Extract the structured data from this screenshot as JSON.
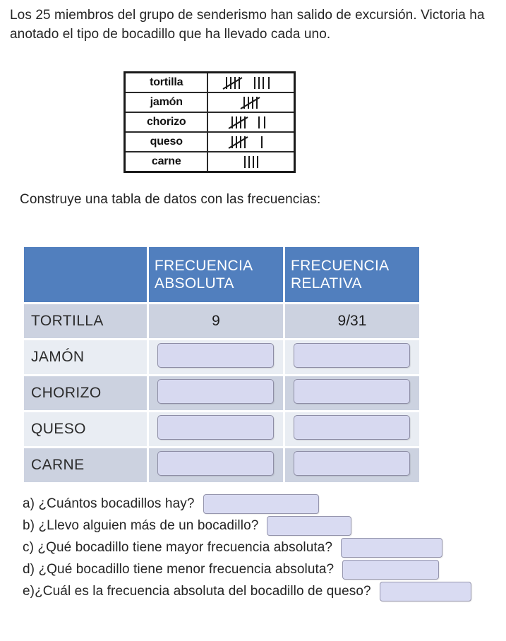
{
  "intro": "Los 25 miembros del grupo de senderismo han salido de excursión. Victoria ha anotado el tipo de bocadillo  que ha llevado cada uno.",
  "construye": "Construye una tabla de datos con las frecuencias:",
  "tally": {
    "rows": [
      {
        "name": "tortilla",
        "fives": 1,
        "ones": 4,
        "count": 9
      },
      {
        "name": "jamón",
        "fives": 1,
        "ones": 0,
        "count": 5
      },
      {
        "name": "chorizo",
        "fives": 1,
        "ones": 2,
        "count": 7
      },
      {
        "name": "queso",
        "fives": 1,
        "ones": 1,
        "count": 6
      },
      {
        "name": "carne",
        "fives": 0,
        "ones": 4,
        "count": 4
      }
    ]
  },
  "freq_table": {
    "header": {
      "blank": "",
      "absolute": "FRECUENCIA ABSOLUTA",
      "absolute_line1": "FRECUENCIA",
      "absolute_line2": "ABSOLUTA",
      "relative_line1": "FRECUENCIA",
      "relative_line2": "RELATIVA"
    },
    "rows": [
      {
        "label": "TORTILLA",
        "absolute": "9",
        "relative": "9/31",
        "filled": true
      },
      {
        "label": "JAMÓN",
        "absolute": "",
        "relative": "",
        "filled": false
      },
      {
        "label": "CHORIZO",
        "absolute": "",
        "relative": "",
        "filled": false
      },
      {
        "label": "QUESO",
        "absolute": "",
        "relative": "",
        "filled": false
      },
      {
        "label": "CARNE",
        "absolute": "",
        "relative": "",
        "filled": false
      }
    ]
  },
  "questions": [
    {
      "text": "a) ¿Cuántos bocadillos hay?",
      "answer": ""
    },
    {
      "text": "b) ¿Llevo alguien más de un bocadillo?",
      "answer": ""
    },
    {
      "text": "c) ¿Qué bocadillo tiene mayor frecuencia absoluta?",
      "answer": ""
    },
    {
      "text": "d) ¿Qué bocadillo tiene menor frecuencia absoluta?",
      "answer": ""
    },
    {
      "text": "e)¿Cuál es la frecuencia absoluta del bocadillo de queso?",
      "answer": ""
    }
  ],
  "colors": {
    "header_blue": "#517fbe",
    "row_dark": "#ccd2e0",
    "row_light": "#e9edf3",
    "input_fill": "#d7d9f0",
    "input_border": "#8e8ea6",
    "text": "#242424"
  }
}
